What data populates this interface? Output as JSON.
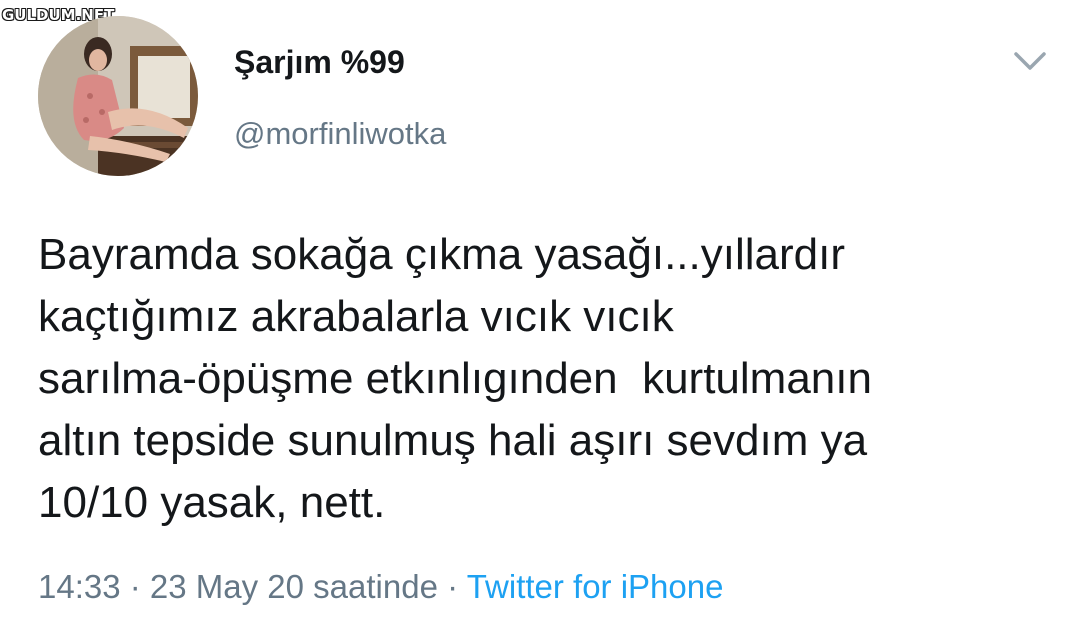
{
  "watermark": "GULDUM.NET",
  "user": {
    "display_name": "Şarjım %99",
    "handle": "@morfinliwotka",
    "avatar_icon": "profile-photo"
  },
  "menu_icon": "chevron-down-icon",
  "tweet": {
    "lines": [
      "Bayramda sokağa çıkma yasağı...yıllardır",
      "kaçtığımız akrabalarla vıcık vıcık",
      "sarılma-öpüşme etkınlıgınden  kurtulmanın",
      "altın tepside sunulmuş hali aşırı sevdım ya",
      "10/10 yasak, nett."
    ]
  },
  "meta": {
    "time": "14:33",
    "sep1": " · ",
    "date": "23 May 20 saatinde",
    "sep2": " · ",
    "source": "Twitter for iPhone"
  },
  "colors": {
    "text": "#14171a",
    "secondary": "#657786",
    "link": "#1da1f2"
  }
}
